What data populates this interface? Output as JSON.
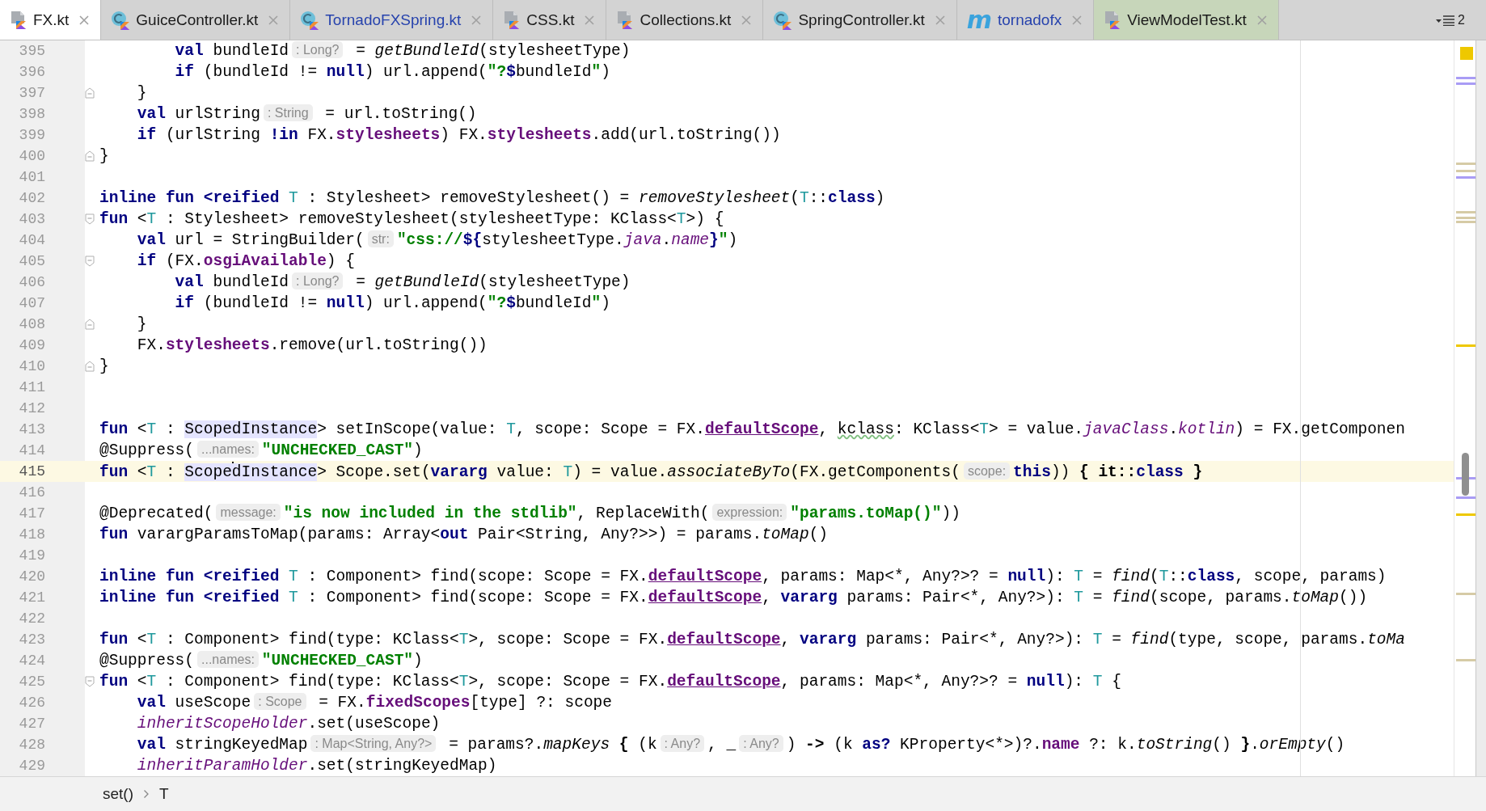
{
  "tabs": [
    {
      "label": "FX.kt",
      "kind": "kotlin-file",
      "selected": true,
      "modified": false
    },
    {
      "label": "GuiceController.kt",
      "kind": "class",
      "selected": false,
      "modified": false
    },
    {
      "label": "TornadoFXSpring.kt",
      "kind": "class",
      "selected": false,
      "modified": true
    },
    {
      "label": "CSS.kt",
      "kind": "kotlin-file",
      "selected": false,
      "modified": false
    },
    {
      "label": "Collections.kt",
      "kind": "kotlin-file",
      "selected": false,
      "modified": false
    },
    {
      "label": "SpringController.kt",
      "kind": "class",
      "selected": false,
      "modified": false
    },
    {
      "label": "tornadofx",
      "kind": "module",
      "icon_text": "m",
      "selected": false,
      "modified": true
    },
    {
      "label": "ViewModelTest.kt",
      "kind": "kotlin-file",
      "selected": false,
      "modified": false,
      "color": "#c7d6ba"
    }
  ],
  "tab_overflow": {
    "count": "2"
  },
  "editor": {
    "lines": [
      {
        "number": "395",
        "tokens": [
          {
            "kind": "keyword",
            "text": "        val"
          },
          {
            "kind": "plain",
            "text": " bundleId"
          },
          {
            "kind": "hint",
            "text": ": Long?"
          },
          {
            "kind": "plain",
            "text": " = "
          },
          {
            "kind": "italic",
            "text": "getBundleId"
          },
          {
            "kind": "plain",
            "text": "(stylesheetType)"
          }
        ]
      },
      {
        "number": "396",
        "tokens": [
          {
            "kind": "keyword",
            "text": "        if"
          },
          {
            "kind": "plain",
            "text": " (bundleId != "
          },
          {
            "kind": "keyword",
            "text": "null"
          },
          {
            "kind": "plain",
            "text": ") url.append("
          },
          {
            "kind": "string",
            "text": "\"?"
          },
          {
            "kind": "keyword",
            "text": "$"
          },
          {
            "kind": "plain",
            "text": "bundleId"
          },
          {
            "kind": "string",
            "text": "\""
          },
          {
            "kind": "plain",
            "text": ")"
          }
        ]
      },
      {
        "number": "397",
        "kind": "fold-end",
        "tokens": [
          {
            "kind": "plain",
            "text": "    }"
          }
        ]
      },
      {
        "number": "398",
        "tokens": [
          {
            "kind": "keyword",
            "text": "    val"
          },
          {
            "kind": "plain",
            "text": " urlString"
          },
          {
            "kind": "hint",
            "text": ": String"
          },
          {
            "kind": "plain",
            "text": " = url.toString()"
          }
        ]
      },
      {
        "number": "399",
        "tokens": [
          {
            "kind": "keyword",
            "text": "    if"
          },
          {
            "kind": "plain",
            "text": " (urlString "
          },
          {
            "kind": "keyword",
            "text": "!in"
          },
          {
            "kind": "plain",
            "text": " FX."
          },
          {
            "kind": "property",
            "text": "stylesheets"
          },
          {
            "kind": "plain",
            "text": ") FX."
          },
          {
            "kind": "property",
            "text": "stylesheets"
          },
          {
            "kind": "plain",
            "text": ".add(url.toString())"
          }
        ]
      },
      {
        "number": "400",
        "kind": "fold-end",
        "tokens": [
          {
            "kind": "plain",
            "text": "}"
          }
        ]
      },
      {
        "number": "401"
      },
      {
        "number": "402",
        "tokens": [
          {
            "kind": "keyword",
            "text": "inline fun <reified "
          },
          {
            "kind": "typeparam",
            "text": "T"
          },
          {
            "kind": "plain",
            "text": " : Stylesheet> removeStylesheet() = "
          },
          {
            "kind": "italic",
            "text": "removeStylesheet"
          },
          {
            "kind": "plain",
            "text": "("
          },
          {
            "kind": "typeparam",
            "text": "T"
          },
          {
            "kind": "plain",
            "text": "::"
          },
          {
            "kind": "keyword",
            "text": "class"
          },
          {
            "kind": "plain",
            "text": ")"
          }
        ]
      },
      {
        "number": "403",
        "kind": "fold-start",
        "tokens": [
          {
            "kind": "keyword",
            "text": "fun"
          },
          {
            "kind": "plain",
            "text": " <"
          },
          {
            "kind": "typeparam",
            "text": "T"
          },
          {
            "kind": "plain",
            "text": " : Stylesheet> removeStylesheet(stylesheetType: KClass<"
          },
          {
            "kind": "typeparam",
            "text": "T"
          },
          {
            "kind": "plain",
            "text": ">) {"
          }
        ]
      },
      {
        "number": "404",
        "tokens": [
          {
            "kind": "keyword",
            "text": "    val"
          },
          {
            "kind": "plain",
            "text": " url = StringBuilder("
          },
          {
            "kind": "hint",
            "text": "str:"
          },
          {
            "kind": "string",
            "text": "\"css://"
          },
          {
            "kind": "keyword",
            "text": "${"
          },
          {
            "kind": "plain",
            "text": "stylesheetType."
          },
          {
            "kind": "italic_property",
            "text": "java"
          },
          {
            "kind": "plain",
            "text": "."
          },
          {
            "kind": "italic_property",
            "text": "name"
          },
          {
            "kind": "keyword",
            "text": "}"
          },
          {
            "kind": "string",
            "text": "\""
          },
          {
            "kind": "plain",
            "text": ")"
          }
        ]
      },
      {
        "number": "405",
        "kind": "fold-start",
        "tokens": [
          {
            "kind": "keyword",
            "text": "    if"
          },
          {
            "kind": "plain",
            "text": " (FX."
          },
          {
            "kind": "property",
            "text": "osgiAvailable"
          },
          {
            "kind": "plain",
            "text": ") {"
          }
        ]
      },
      {
        "number": "406",
        "tokens": [
          {
            "kind": "keyword",
            "text": "        val"
          },
          {
            "kind": "plain",
            "text": " bundleId"
          },
          {
            "kind": "hint",
            "text": ": Long?"
          },
          {
            "kind": "plain",
            "text": " = "
          },
          {
            "kind": "italic",
            "text": "getBundleId"
          },
          {
            "kind": "plain",
            "text": "(stylesheetType)"
          }
        ]
      },
      {
        "number": "407",
        "tokens": [
          {
            "kind": "keyword",
            "text": "        if"
          },
          {
            "kind": "plain",
            "text": " (bundleId != "
          },
          {
            "kind": "keyword",
            "text": "null"
          },
          {
            "kind": "plain",
            "text": ") url.append("
          },
          {
            "kind": "string",
            "text": "\"?"
          },
          {
            "kind": "keyword",
            "text": "$"
          },
          {
            "kind": "plain",
            "text": "bundleId"
          },
          {
            "kind": "string",
            "text": "\""
          },
          {
            "kind": "plain",
            "text": ")"
          }
        ]
      },
      {
        "number": "408",
        "kind": "fold-end",
        "tokens": [
          {
            "kind": "plain",
            "text": "    }"
          }
        ]
      },
      {
        "number": "409",
        "tokens": [
          {
            "kind": "plain",
            "text": "    FX."
          },
          {
            "kind": "property",
            "text": "stylesheets"
          },
          {
            "kind": "plain",
            "text": ".remove(url.toString())"
          }
        ]
      },
      {
        "number": "410",
        "kind": "fold-end",
        "tokens": [
          {
            "kind": "plain",
            "text": "}"
          }
        ]
      },
      {
        "number": "411"
      },
      {
        "number": "412"
      },
      {
        "number": "413",
        "tokens": [
          {
            "kind": "keyword",
            "text": "fun"
          },
          {
            "kind": "plain",
            "text": " <"
          },
          {
            "kind": "typeparam",
            "text": "T"
          },
          {
            "kind": "plain",
            "text": " : "
          },
          {
            "kind": "highlight",
            "text": "ScopedInstance"
          },
          {
            "kind": "plain",
            "text": "> setInScope(value: "
          },
          {
            "kind": "typeparam",
            "text": "T"
          },
          {
            "kind": "plain",
            "text": ", scope: Scope = FX."
          },
          {
            "kind": "link",
            "text": "defaultScope"
          },
          {
            "kind": "plain",
            "text": ", "
          },
          {
            "kind": "typo",
            "text": "kclass"
          },
          {
            "kind": "plain",
            "text": ": KClass<"
          },
          {
            "kind": "typeparam",
            "text": "T"
          },
          {
            "kind": "plain",
            "text": "> = value."
          },
          {
            "kind": "italic_property",
            "text": "javaClass"
          },
          {
            "kind": "plain",
            "text": "."
          },
          {
            "kind": "italic_property",
            "text": "kotlin"
          },
          {
            "kind": "plain",
            "text": ") = FX.getComponen"
          }
        ]
      },
      {
        "number": "414",
        "tokens": [
          {
            "kind": "plain",
            "text": "@Suppress("
          },
          {
            "kind": "hint",
            "text": "...names:"
          },
          {
            "kind": "string",
            "text": "\"UNCHECKED_CAST\""
          },
          {
            "kind": "plain",
            "text": ")"
          }
        ]
      },
      {
        "number": "415",
        "current": true,
        "tokens": [
          {
            "kind": "keyword",
            "text": "fun"
          },
          {
            "kind": "plain",
            "text": " <"
          },
          {
            "kind": "typeparam",
            "text": "T"
          },
          {
            "kind": "plain",
            "text": " : "
          },
          {
            "kind": "highlight",
            "text": "Scope",
            "caret": true
          },
          {
            "kind": "highlight",
            "text": "dInstance"
          },
          {
            "kind": "plain",
            "text": "> Scope.set("
          },
          {
            "kind": "keyword",
            "text": "vararg"
          },
          {
            "kind": "plain",
            "text": " value: "
          },
          {
            "kind": "typeparam",
            "text": "T"
          },
          {
            "kind": "plain",
            "text": ") = value."
          },
          {
            "kind": "italic",
            "text": "associateByTo"
          },
          {
            "kind": "plain",
            "text": "(FX.getComponents("
          },
          {
            "kind": "hint",
            "text": "scope:"
          },
          {
            "kind": "keyword",
            "text": "this"
          },
          {
            "kind": "plain",
            "text": ")) "
          },
          {
            "kind": "bold",
            "text": "{ it::"
          },
          {
            "kind": "keyword",
            "text": "class"
          },
          {
            "kind": "bold",
            "text": " }"
          }
        ]
      },
      {
        "number": "416"
      },
      {
        "number": "417",
        "tokens": [
          {
            "kind": "plain",
            "text": "@Deprecated("
          },
          {
            "kind": "hint",
            "text": "message:"
          },
          {
            "kind": "string",
            "text": "\"is now included in the stdlib\""
          },
          {
            "kind": "plain",
            "text": ", ReplaceWith("
          },
          {
            "kind": "hint",
            "text": "expression:"
          },
          {
            "kind": "string",
            "text": "\"params.toMap()\""
          },
          {
            "kind": "plain",
            "text": "))"
          }
        ]
      },
      {
        "number": "418",
        "tokens": [
          {
            "kind": "keyword",
            "text": "fun"
          },
          {
            "kind": "plain",
            "text": " varargParamsToMap(params: Array<"
          },
          {
            "kind": "keyword",
            "text": "out"
          },
          {
            "kind": "plain",
            "text": " Pair<String, Any?>>) = params."
          },
          {
            "kind": "italic",
            "text": "toMap"
          },
          {
            "kind": "plain",
            "text": "()"
          }
        ]
      },
      {
        "number": "419"
      },
      {
        "number": "420",
        "tokens": [
          {
            "kind": "keyword",
            "text": "inline fun <reified "
          },
          {
            "kind": "typeparam",
            "text": "T"
          },
          {
            "kind": "plain",
            "text": " : Component> find(scope: Scope = FX."
          },
          {
            "kind": "link",
            "text": "defaultScope"
          },
          {
            "kind": "plain",
            "text": ", params: Map<*, Any?>? = "
          },
          {
            "kind": "keyword",
            "text": "null"
          },
          {
            "kind": "plain",
            "text": "): "
          },
          {
            "kind": "typeparam",
            "text": "T"
          },
          {
            "kind": "plain",
            "text": " = "
          },
          {
            "kind": "italic",
            "text": "find"
          },
          {
            "kind": "plain",
            "text": "("
          },
          {
            "kind": "typeparam",
            "text": "T"
          },
          {
            "kind": "plain",
            "text": "::"
          },
          {
            "kind": "keyword",
            "text": "class"
          },
          {
            "kind": "plain",
            "text": ", scope, params)"
          }
        ]
      },
      {
        "number": "421",
        "tokens": [
          {
            "kind": "keyword",
            "text": "inline fun <reified "
          },
          {
            "kind": "typeparam",
            "text": "T"
          },
          {
            "kind": "plain",
            "text": " : Component> find(scope: Scope = FX."
          },
          {
            "kind": "link",
            "text": "defaultScope"
          },
          {
            "kind": "plain",
            "text": ", "
          },
          {
            "kind": "keyword",
            "text": "vararg"
          },
          {
            "kind": "plain",
            "text": " params: Pair<*, Any?>): "
          },
          {
            "kind": "typeparam",
            "text": "T"
          },
          {
            "kind": "plain",
            "text": " = "
          },
          {
            "kind": "italic",
            "text": "find"
          },
          {
            "kind": "plain",
            "text": "(scope, params."
          },
          {
            "kind": "italic",
            "text": "toMap"
          },
          {
            "kind": "plain",
            "text": "())"
          }
        ]
      },
      {
        "number": "422"
      },
      {
        "number": "423",
        "tokens": [
          {
            "kind": "keyword",
            "text": "fun"
          },
          {
            "kind": "plain",
            "text": " <"
          },
          {
            "kind": "typeparam",
            "text": "T"
          },
          {
            "kind": "plain",
            "text": " : Component> find(type: KClass<"
          },
          {
            "kind": "typeparam",
            "text": "T"
          },
          {
            "kind": "plain",
            "text": ">, scope: Scope = FX."
          },
          {
            "kind": "link",
            "text": "defaultScope"
          },
          {
            "kind": "plain",
            "text": ", "
          },
          {
            "kind": "keyword",
            "text": "vararg"
          },
          {
            "kind": "plain",
            "text": " params: Pair<*, Any?>): "
          },
          {
            "kind": "typeparam",
            "text": "T"
          },
          {
            "kind": "plain",
            "text": " = "
          },
          {
            "kind": "italic",
            "text": "find"
          },
          {
            "kind": "plain",
            "text": "(type, scope, params."
          },
          {
            "kind": "italic",
            "text": "toMa"
          }
        ]
      },
      {
        "number": "424",
        "tokens": [
          {
            "kind": "plain",
            "text": "@Suppress("
          },
          {
            "kind": "hint",
            "text": "...names:"
          },
          {
            "kind": "string",
            "text": "\"UNCHECKED_CAST\""
          },
          {
            "kind": "plain",
            "text": ")"
          }
        ]
      },
      {
        "number": "425",
        "kind": "fold-start",
        "tokens": [
          {
            "kind": "keyword",
            "text": "fun"
          },
          {
            "kind": "plain",
            "text": " <"
          },
          {
            "kind": "typeparam",
            "text": "T"
          },
          {
            "kind": "plain",
            "text": " : Component> find(type: KClass<"
          },
          {
            "kind": "typeparam",
            "text": "T"
          },
          {
            "kind": "plain",
            "text": ">, scope: Scope = FX."
          },
          {
            "kind": "link",
            "text": "defaultScope"
          },
          {
            "kind": "plain",
            "text": ", params: Map<*, Any?>? = "
          },
          {
            "kind": "keyword",
            "text": "null"
          },
          {
            "kind": "plain",
            "text": "): "
          },
          {
            "kind": "typeparam",
            "text": "T"
          },
          {
            "kind": "plain",
            "text": " {"
          }
        ]
      },
      {
        "number": "426",
        "tokens": [
          {
            "kind": "keyword",
            "text": "    val"
          },
          {
            "kind": "plain",
            "text": " useScope"
          },
          {
            "kind": "hint",
            "text": ": Scope"
          },
          {
            "kind": "plain",
            "text": " = FX."
          },
          {
            "kind": "property",
            "text": "fixedScopes"
          },
          {
            "kind": "plain",
            "text": "[type] ?: scope"
          }
        ]
      },
      {
        "number": "427",
        "tokens": [
          {
            "kind": "italic_property",
            "text": "    inheritScopeHolder"
          },
          {
            "kind": "plain",
            "text": ".set(useScope)"
          }
        ]
      },
      {
        "number": "428",
        "tokens": [
          {
            "kind": "keyword",
            "text": "    val"
          },
          {
            "kind": "plain",
            "text": " stringKeyedMap"
          },
          {
            "kind": "hint",
            "text": ": Map<String, Any?>"
          },
          {
            "kind": "plain",
            "text": " = params?."
          },
          {
            "kind": "italic",
            "text": "mapKeys"
          },
          {
            "kind": "bold",
            "text": " {"
          },
          {
            "kind": "plain",
            "text": " (k"
          },
          {
            "kind": "hint",
            "text": ": Any?"
          },
          {
            "kind": "plain",
            "text": ", _"
          },
          {
            "kind": "hint",
            "text": ": Any?"
          },
          {
            "kind": "plain",
            "text": ") "
          },
          {
            "kind": "bold",
            "text": "->"
          },
          {
            "kind": "plain",
            "text": " (k "
          },
          {
            "kind": "keyword",
            "text": "as?"
          },
          {
            "kind": "plain",
            "text": " KProperty<*>)?."
          },
          {
            "kind": "property",
            "text": "name"
          },
          {
            "kind": "plain",
            "text": " ?: k."
          },
          {
            "kind": "italic",
            "text": "toString"
          },
          {
            "kind": "plain",
            "text": "() "
          },
          {
            "kind": "bold",
            "text": "}"
          },
          {
            "kind": "plain",
            "text": "."
          },
          {
            "kind": "italic",
            "text": "orEmpty"
          },
          {
            "kind": "plain",
            "text": "()"
          }
        ]
      },
      {
        "number": "429",
        "tokens": [
          {
            "kind": "italic_property",
            "text": "    inheritParamHolder"
          },
          {
            "kind": "plain",
            "text": ".set(stringKeyedMap)"
          }
        ]
      }
    ]
  },
  "breadcrumbs": [
    "set()",
    "T"
  ]
}
